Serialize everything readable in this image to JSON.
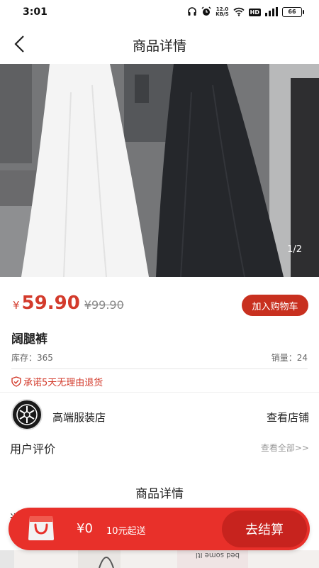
{
  "status_bar": {
    "time": "3:01",
    "speed_value": "12.0",
    "speed_unit": "KB/S",
    "hd_label": "HD",
    "battery": "66"
  },
  "header": {
    "title": "商品详情",
    "back_icon": "chevron-left-icon"
  },
  "gallery": {
    "counter": "1/2"
  },
  "product": {
    "currency": "¥",
    "price": "59.90",
    "original_price": "¥99.90",
    "add_to_cart": "加入购物车",
    "name": "阔腿裤",
    "stock": "库存：365",
    "sales": "销量：24",
    "promise": "承诺5天无理由退货"
  },
  "store": {
    "name": "高端服装店",
    "view_store": "查看店铺"
  },
  "reviews": {
    "title": "用户评价",
    "view_all": "查看全部>>"
  },
  "detail": {
    "title": "商品详情",
    "peek_text": "送"
  },
  "bottom_bar": {
    "total": "¥0",
    "min_order": "10元起送",
    "checkout": "去结算"
  },
  "colors": {
    "accent": "#d33b2c",
    "bar": "#e8302a",
    "checkout": "#c7231e"
  }
}
